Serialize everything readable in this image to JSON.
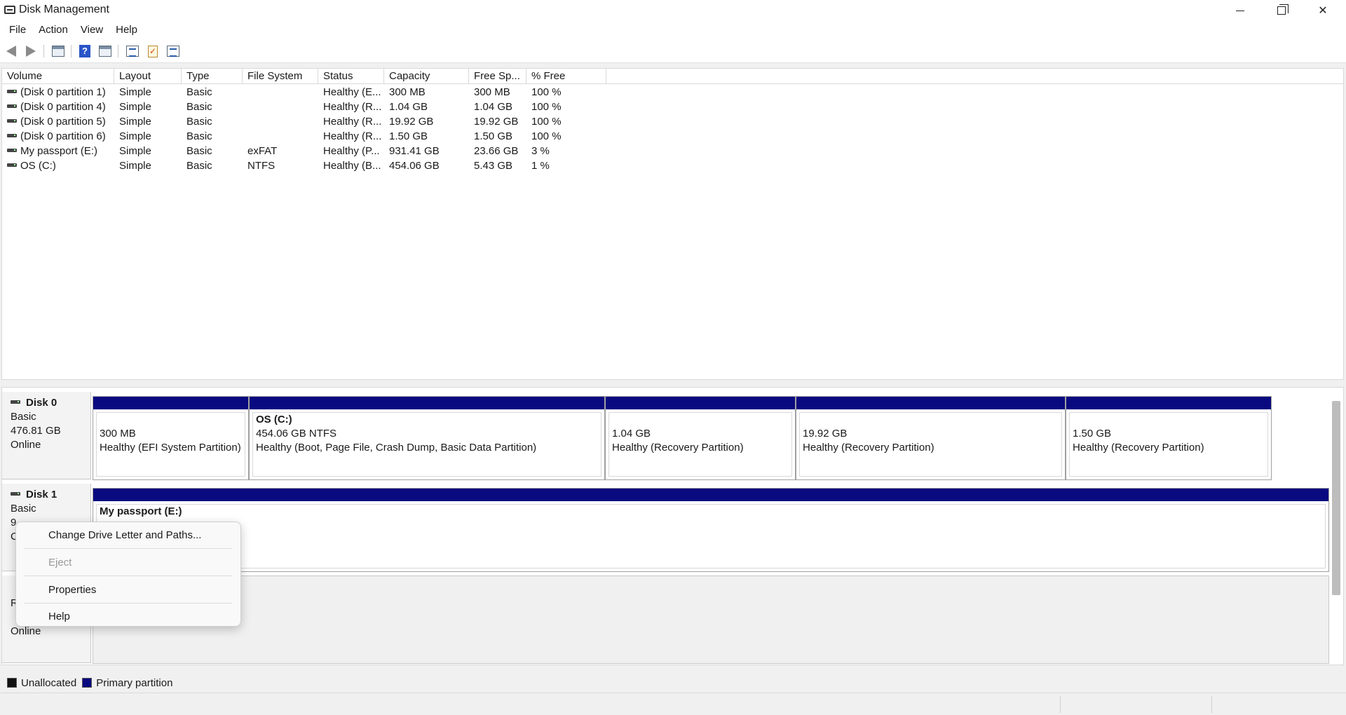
{
  "window": {
    "title": "Disk Management",
    "app_icon": "disk-management-icon",
    "controls": [
      "minimize-icon",
      "restore-icon",
      "close-icon"
    ]
  },
  "menu": [
    "File",
    "Action",
    "View",
    "Help"
  ],
  "toolbar": {
    "icons": [
      "back-arrow-icon",
      "forward-arrow-icon",
      "console-tree-icon",
      "help-icon",
      "show-hide-action-pane-icon",
      "rescan-disks-icon",
      "checklist-icon",
      "properties-list-icon"
    ]
  },
  "volume_table": {
    "columns": [
      "Volume",
      "Layout",
      "Type",
      "File System",
      "Status",
      "Capacity",
      "Free Sp...",
      "% Free"
    ],
    "rows": [
      [
        "(Disk 0 partition 1)",
        "Simple",
        "Basic",
        "",
        "Healthy (E...",
        "300 MB",
        "300 MB",
        "100 %"
      ],
      [
        "(Disk 0 partition 4)",
        "Simple",
        "Basic",
        "",
        "Healthy (R...",
        "1.04 GB",
        "1.04 GB",
        "100 %"
      ],
      [
        "(Disk 0 partition 5)",
        "Simple",
        "Basic",
        "",
        "Healthy (R...",
        "19.92 GB",
        "19.92 GB",
        "100 %"
      ],
      [
        "(Disk 0 partition 6)",
        "Simple",
        "Basic",
        "",
        "Healthy (R...",
        "1.50 GB",
        "1.50 GB",
        "100 %"
      ],
      [
        "My passport (E:)",
        "Simple",
        "Basic",
        "exFAT",
        "Healthy (P...",
        "931.41 GB",
        "23.66 GB",
        "3 %"
      ],
      [
        "OS (C:)",
        "Simple",
        "Basic",
        "NTFS",
        "Healthy (B...",
        "454.06 GB",
        "5.43 GB",
        "1 %"
      ]
    ]
  },
  "disks": [
    {
      "name": "Disk 0",
      "type": "Basic",
      "size": "476.81 GB",
      "state": "Online",
      "partitions": [
        {
          "title": "",
          "size": "300 MB",
          "status": "Healthy (EFI System Partition)"
        },
        {
          "title": "OS  (C:)",
          "size": "454.06 GB NTFS",
          "status": "Healthy (Boot, Page File, Crash Dump, Basic Data Partition)"
        },
        {
          "title": "",
          "size": "1.04 GB",
          "status": "Healthy (Recovery Partition)"
        },
        {
          "title": "",
          "size": "19.92 GB",
          "status": "Healthy (Recovery Partition)"
        },
        {
          "title": "",
          "size": "1.50 GB",
          "status": "Healthy (Recovery Partition)"
        }
      ]
    },
    {
      "name": "Disk 1",
      "type": "Basic",
      "size_visible": "9",
      "state_visible": "C",
      "partitions": [
        {
          "title": "My passport  (E:)"
        }
      ]
    },
    {
      "type_visible": "R",
      "state": "Online"
    }
  ],
  "legend": [
    {
      "label": "Unallocated",
      "color": "#111111"
    },
    {
      "label": "Primary partition",
      "color": "#0a0a80"
    }
  ],
  "context_menu": [
    {
      "label": "Change Drive Letter and Paths...",
      "enabled": true
    },
    {
      "label": "Eject",
      "enabled": false
    },
    {
      "label": "Properties",
      "enabled": true
    },
    {
      "label": "Help",
      "enabled": true
    }
  ]
}
